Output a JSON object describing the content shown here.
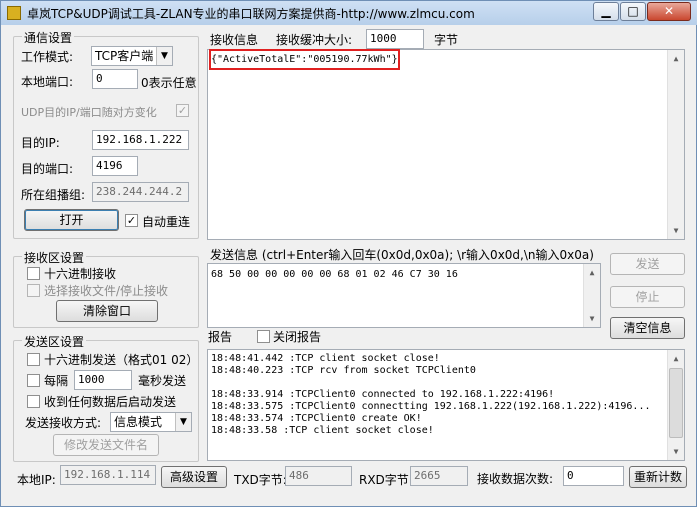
{
  "window": {
    "title": "卓岚TCP&UDP调试工具-ZLAN专业的串口联网方案提供商-http://www.zlmcu.com",
    "min_glyph": "▁",
    "max_glyph": "□",
    "close_glyph": "✕"
  },
  "comm": {
    "group_title": "通信设置",
    "mode_label": "工作模式:",
    "mode_value": "TCP客户端",
    "local_port_label": "本地端口:",
    "local_port_value": "0",
    "local_port_hint": "0表示任意",
    "udp_random_label": "UDP目的IP/端口随对方变化",
    "dest_ip_label": "目的IP:",
    "dest_ip_value": "192.168.1.222",
    "dest_port_label": "目的端口:",
    "dest_port_value": "4196",
    "multicast_label": "所在组播组:",
    "multicast_value": "238.244.244.2",
    "open_button": "打开",
    "auto_reconnect_label": "自动重连"
  },
  "recv_settings": {
    "group_title": "接收区设置",
    "hex_label": "十六进制接收",
    "select_file_label": "选择接收文件/停止接收",
    "clear_button": "清除窗口"
  },
  "send_settings": {
    "group_title": "发送区设置",
    "hex_label": "十六进制发送（格式01 02）",
    "every_label": "每隔",
    "every_value": "1000",
    "ms_label": "毫秒发送",
    "on_recv_label": "收到任何数据后启动发送",
    "method_label": "发送接收方式:",
    "method_value": "信息模式",
    "modify_file_button": "修改发送文件名"
  },
  "receive": {
    "label": "接收信息",
    "buffer_label": "接收缓冲大小:",
    "buffer_value": "1000",
    "bytes_label": "字节",
    "content": "{\"ActiveTotalE\":\"005190.77kWh\"}"
  },
  "send": {
    "label": "发送信息 (ctrl+Enter输入回车(0x0d,0x0a); \\r输入0x0d,\\n输入0x0a)",
    "content": "68 50 00 00 00 00 00 68 01 02 46 C7 30 16",
    "send_button": "发送",
    "stop_button": "停止",
    "clear_info_button": "清空信息"
  },
  "report": {
    "label": "报告",
    "close_report_label": "关闭报告",
    "lines": [
      "18:48:41.442 :TCP client socket close!",
      "18:48:40.223 :TCP rcv from socket TCPClient0",
      "",
      "18:48:33.914 :TCPClient0 connected to 192.168.1.222:4196!",
      "18:48:33.575 :TCPClient0 connectting 192.168.1.222(192.168.1.222):4196...",
      "18:48:33.574 :TCPClient0 create OK!",
      "18:48:33.58 :TCP client socket close!"
    ]
  },
  "status": {
    "local_ip_label": "本地IP:",
    "local_ip_value": "192.168.1.114",
    "advanced_button": "高级设置",
    "txd_label": "TXD字节:",
    "txd_value": "486",
    "rxd_label": "RXD字节:",
    "rxd_value": "2665",
    "recv_count_label": "接收数据次数:",
    "recv_count_value": "0",
    "recount_button": "重新计数"
  }
}
